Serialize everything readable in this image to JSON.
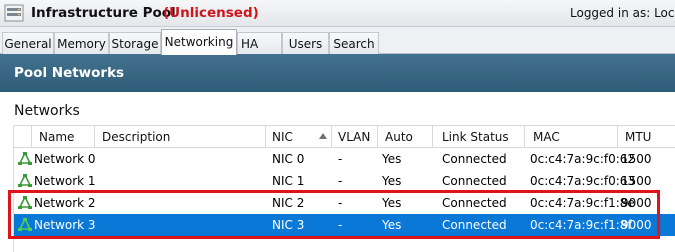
{
  "window": {
    "title": "Infrastructure Pool",
    "status": "(Unlicensed)",
    "logged_in": "Logged in as:  Local"
  },
  "tabs": [
    {
      "label": "General",
      "active": false
    },
    {
      "label": "Memory",
      "active": false
    },
    {
      "label": "Storage",
      "active": false
    },
    {
      "label": "Networking",
      "active": true
    },
    {
      "label": "HA",
      "active": false
    },
    {
      "label": "Users",
      "active": false
    },
    {
      "label": "Search",
      "active": false
    }
  ],
  "section": {
    "title": "Pool Networks",
    "subtitle": "Networks"
  },
  "grid": {
    "columns": [
      "Name",
      "Description",
      "NIC",
      "VLAN",
      "Auto",
      "Link Status",
      "MAC",
      "MTU"
    ],
    "sorted_column": "NIC",
    "rows": [
      {
        "name": "Network 0",
        "description": "",
        "nic": "NIC 0",
        "vlan": "-",
        "auto": "Yes",
        "link_status": "Connected",
        "mac": "0c:c4:7a:9c:f0:62",
        "mtu": "1500",
        "selected": false
      },
      {
        "name": "Network 1",
        "description": "",
        "nic": "NIC 1",
        "vlan": "-",
        "auto": "Yes",
        "link_status": "Connected",
        "mac": "0c:c4:7a:9c:f0:63",
        "mtu": "1500",
        "selected": false
      },
      {
        "name": "Network 2",
        "description": "",
        "nic": "NIC 2",
        "vlan": "-",
        "auto": "Yes",
        "link_status": "Connected",
        "mac": "0c:c4:7a:9c:f1:8e",
        "mtu": "9000",
        "selected": false
      },
      {
        "name": "Network 3",
        "description": "",
        "nic": "NIC 3",
        "vlan": "-",
        "auto": "Yes",
        "link_status": "Connected",
        "mac": "0c:c4:7a:9c:f1:8f",
        "mtu": "9000",
        "selected": true
      }
    ]
  },
  "icons": {
    "pool": "pool-icon",
    "network": "network-icon"
  },
  "colors": {
    "status_red": "#d0141c",
    "header_blue": "#3a6783",
    "selection_blue": "#0a78d7",
    "annotation_red": "#e0121a"
  }
}
